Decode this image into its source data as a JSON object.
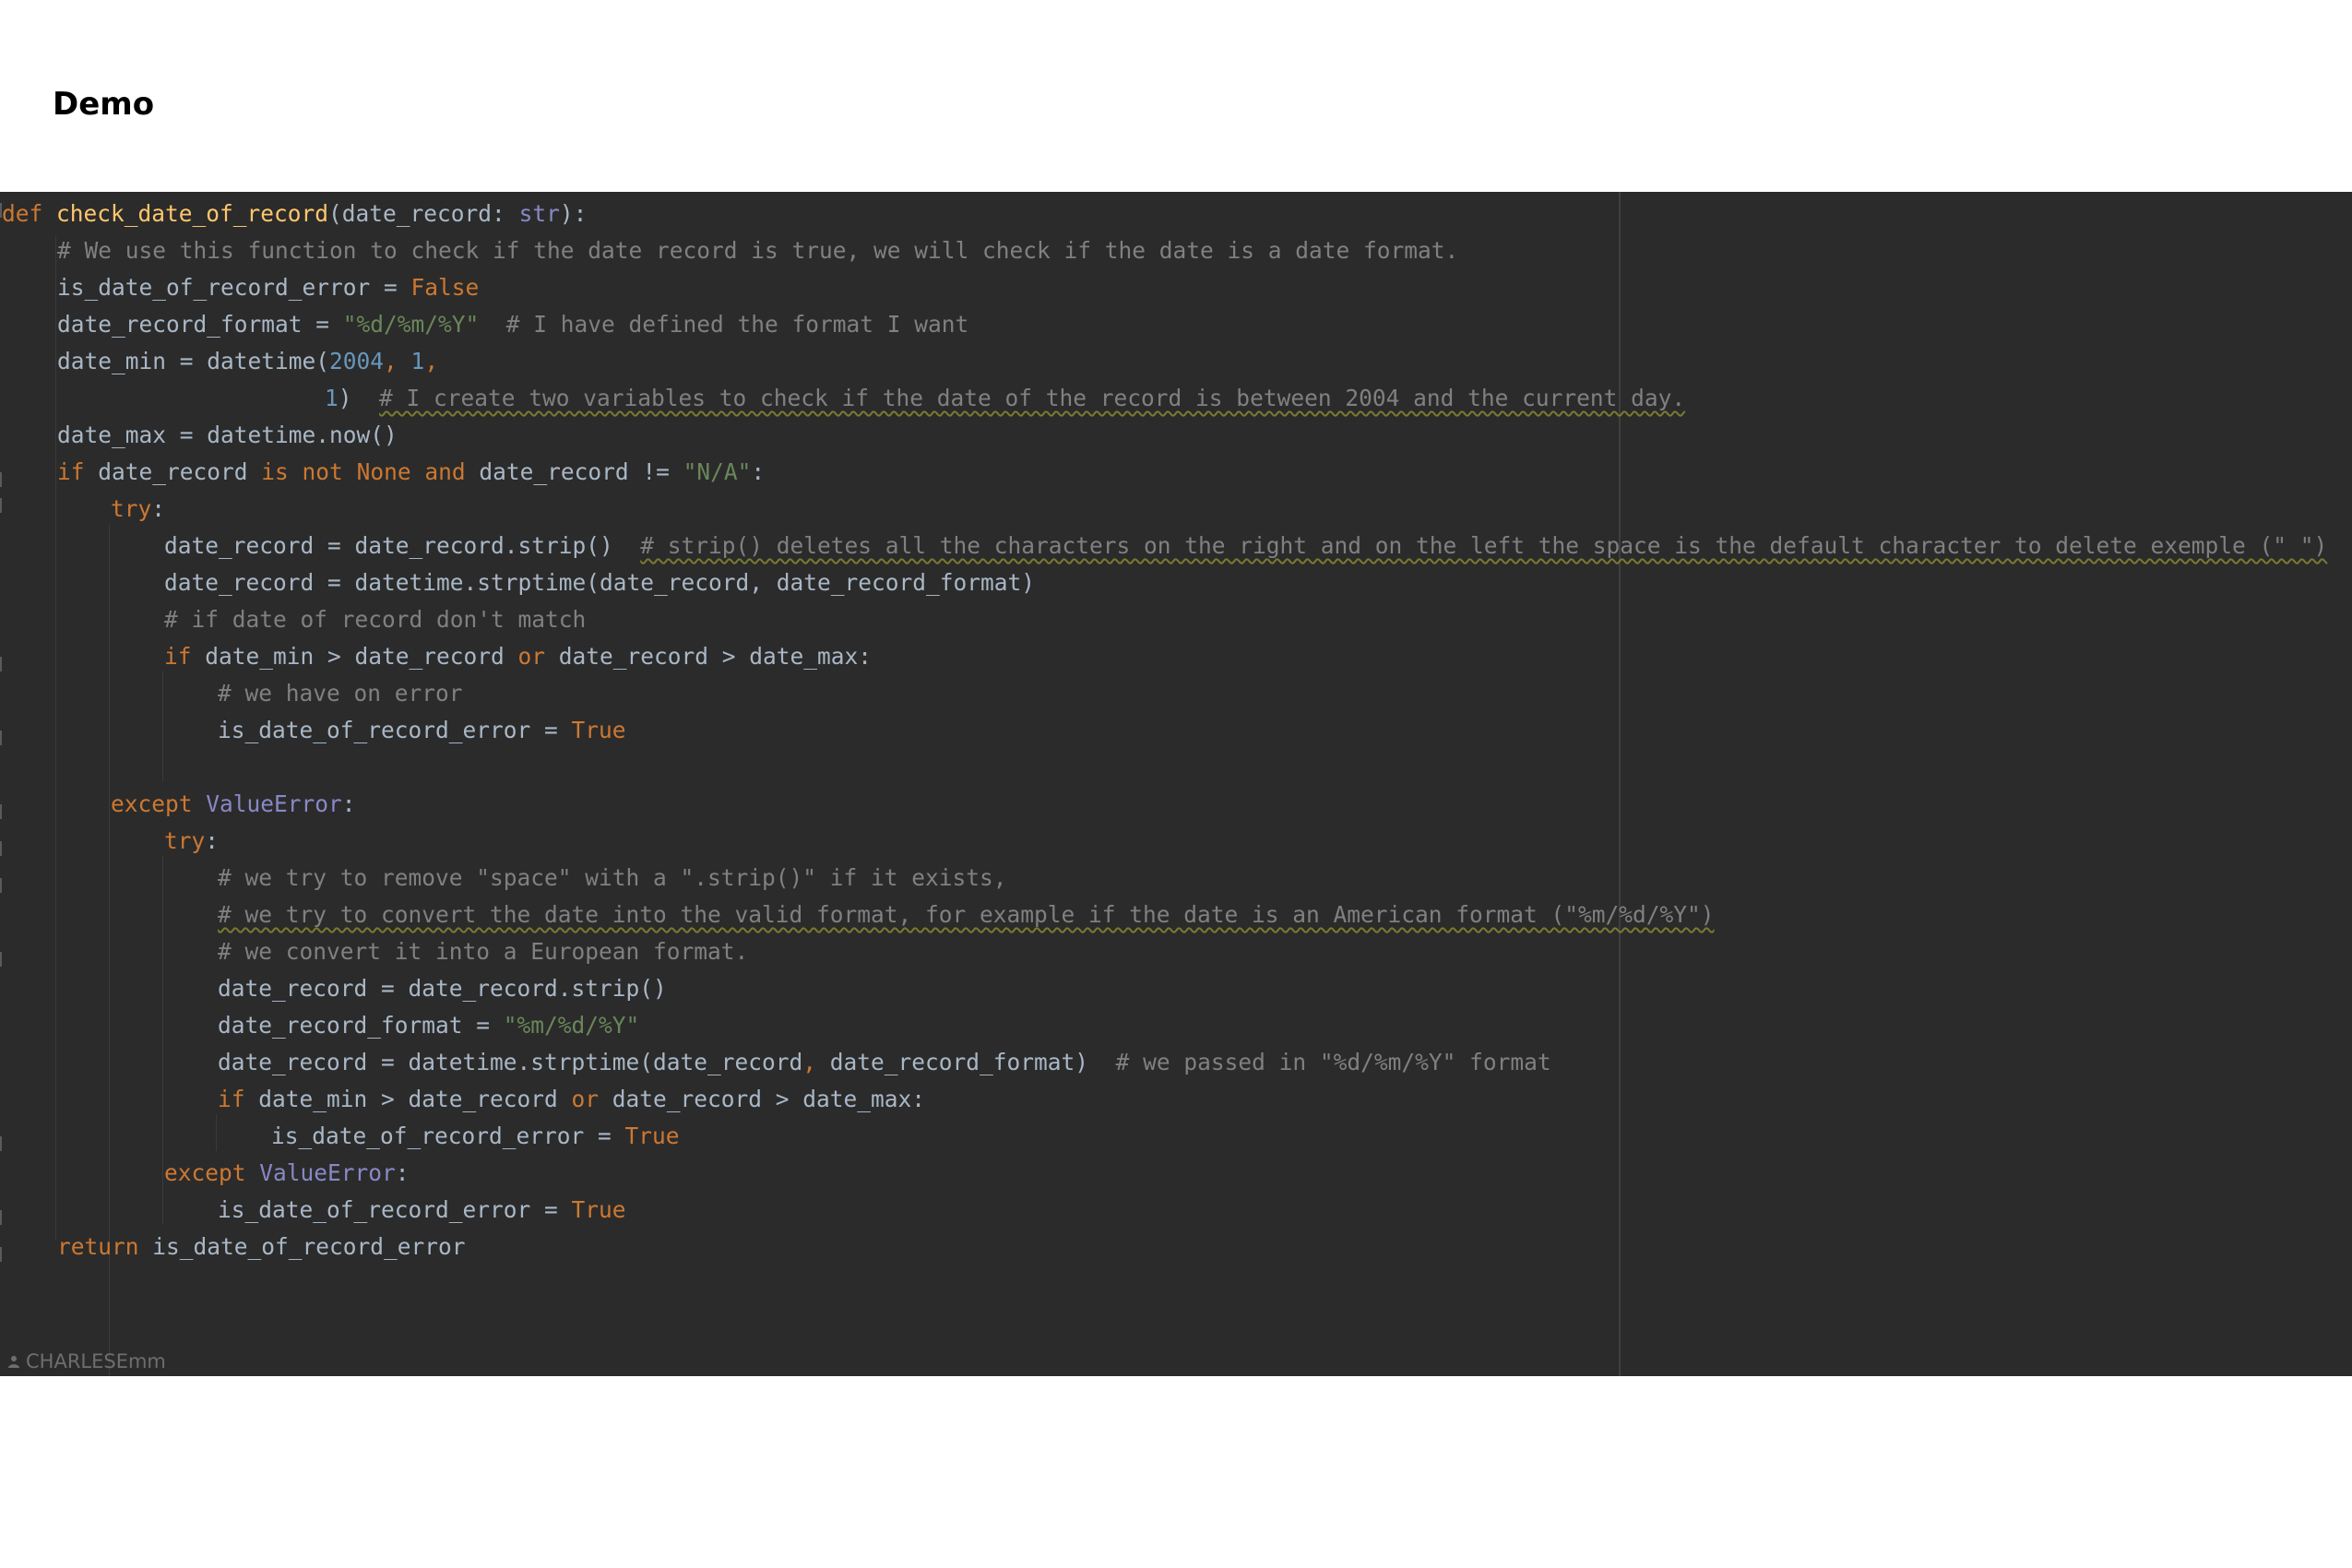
{
  "page": {
    "title": "Demo"
  },
  "editor": {
    "author": "CHARLESEmm",
    "author_icon": "person-icon",
    "colors": {
      "background": "#2b2b2b",
      "keyword": "#cc7832",
      "function": "#ffc66d",
      "comment": "#808080",
      "string": "#6a8759",
      "number": "#6897bb",
      "builtin": "#8888c6",
      "text": "#a9b7c6"
    },
    "code": {
      "def_kw": "def",
      "fn_name": "check_date_of_record",
      "sig_open": "(date_record: ",
      "sig_type": "str",
      "sig_close": "):",
      "l2_comment": "# We use this function to check if the date record is true, we will check if the date is a date format.",
      "l3_text": "is_date_of_record_error = ",
      "l3_val": "False",
      "l4_text": "date_record_format = ",
      "l4_str": "\"%d/%m/%Y\"",
      "l4_comment": "# I have defined the format I want",
      "l5_text": "date_min = datetime(",
      "l5_n1": "2004",
      "l5_sep1": ", ",
      "l5_n2": "1",
      "l5_sep2": ",",
      "l6_n": "1",
      "l6_close": ")",
      "l6_comment": "# I create two variables to check if the date of the record is between 2004 and the current day.",
      "l7_text": "date_max = datetime.now()",
      "l8_if": "if",
      "l8_a": " date_record ",
      "l8_is": "is not",
      "l8_none": "None",
      "l8_and": "and",
      "l8_b": " date_record != ",
      "l8_str": "\"N/A\"",
      "l8_colon": ":",
      "l9_try": "try",
      "l9_colon": ":",
      "l10_text": "date_record = date_record.strip()",
      "l10_comment": "# strip() deletes all the characters on the right and on the left the space is the default character to delete exemple (\" \")",
      "l11_text": "date_record = datetime.strptime(date_record, date_record_format)",
      "l12_comment": "# if date of record don't match",
      "l13_if": "if",
      "l13_a": " date_min > date_record ",
      "l13_or": "or",
      "l13_b": " date_record > date_max:",
      "l14_comment": "# we have on error",
      "l15_text": "is_date_of_record_error = ",
      "l15_val": "True",
      "l17_except": "except",
      "l17_err": "ValueError",
      "l17_colon": ":",
      "l18_try": "try",
      "l18_colon": ":",
      "l19_comment": "# we try to remove \"space\" with a \".strip()\" if it exists,",
      "l20_comment": "# we try to convert the date into the valid format, for example if the date is an American format (\"%m/%d/%Y\")",
      "l21_comment": "# we convert it into a European format.",
      "l22_text": "date_record = date_record.strip()",
      "l23_text": "date_record_format = ",
      "l23_str": "\"%m/%d/%Y\"",
      "l24_a": "date_record = datetime.strptime(date_record",
      "l24_comma": ",",
      "l24_b": " date_record_format)",
      "l24_comment": "# we passed in \"%d/%m/%Y\" format",
      "l25_if": "if",
      "l25_a": " date_min > date_record ",
      "l25_or": "or",
      "l25_b": " date_record > date_max:",
      "l26_text": "is_date_of_record_error = ",
      "l26_val": "True",
      "l27_except": "except",
      "l27_err": "ValueError",
      "l27_colon": ":",
      "l28_text": "is_date_of_record_error = ",
      "l28_val": "True",
      "l29_return": "return",
      "l29_text": " is_date_of_record_error"
    }
  }
}
